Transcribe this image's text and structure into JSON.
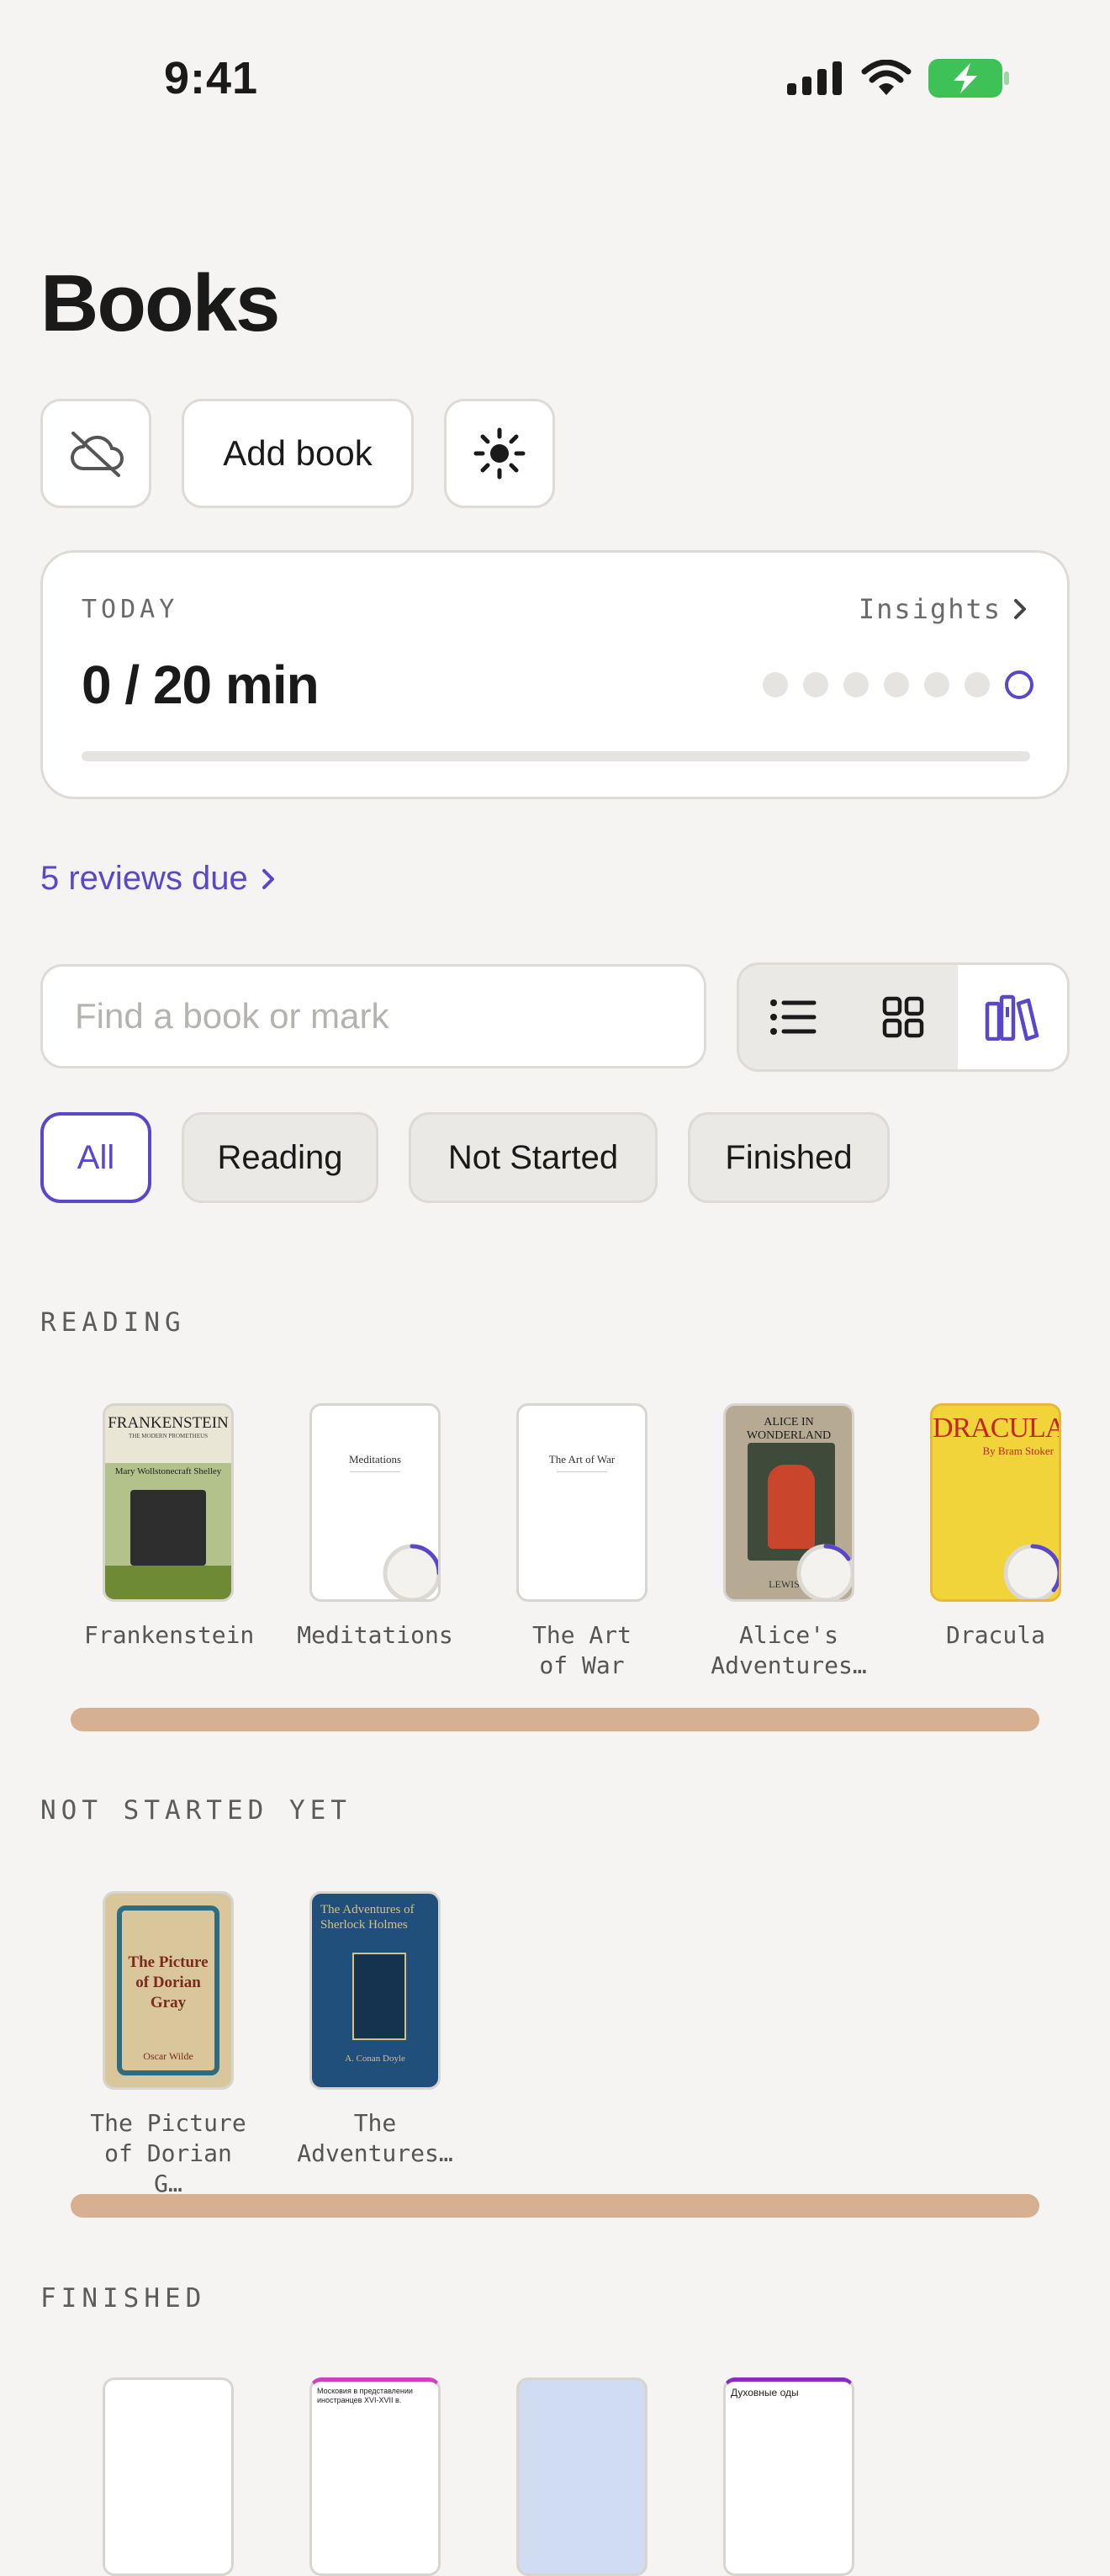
{
  "status_bar": {
    "time": "9:41"
  },
  "header": {
    "title": "Books",
    "add_book_label": "Add book"
  },
  "today": {
    "label": "TODAY",
    "insights_label": "Insights",
    "value": "0 / 20 min",
    "progress_fraction": 0,
    "week_dots": 7
  },
  "reviews_link": "5 reviews due",
  "search": {
    "placeholder": "Find a book or mark"
  },
  "view_modes": [
    "list",
    "grid",
    "shelf"
  ],
  "active_view": "shelf",
  "filters": [
    "All",
    "Reading",
    "Not Started",
    "Finished"
  ],
  "active_filter": "All",
  "sections": {
    "reading": {
      "label": "READING",
      "books": [
        {
          "title_lines": [
            "Frankenstein"
          ],
          "progress": 0,
          "cover": "frankenstein"
        },
        {
          "title_lines": [
            "Meditations"
          ],
          "progress": 0.3,
          "cover": "meditations"
        },
        {
          "title_lines": [
            "The Art",
            "of War"
          ],
          "progress": 0,
          "cover": "art-of-war"
        },
        {
          "title_lines": [
            "Alice's",
            "Adventures…"
          ],
          "progress": 0.2,
          "cover": "alice"
        },
        {
          "title_lines": [
            "Dracula"
          ],
          "progress": 0.4,
          "cover": "dracula"
        }
      ]
    },
    "not_started": {
      "label": "NOT STARTED YET",
      "books": [
        {
          "title_lines": [
            "The Picture",
            "of Dorian G…"
          ],
          "cover": "dorian"
        },
        {
          "title_lines": [
            "The",
            "Adventures…"
          ],
          "cover": "holmes"
        }
      ]
    },
    "finished": {
      "label": "FINISHED"
    }
  },
  "cover_text": {
    "frankenstein": {
      "t1": "FRANKENSTEIN",
      "t2": "THE MODERN PROMETHEUS",
      "t3": "Mary Wollstonecraft Shelley"
    },
    "meditations": {
      "t1": "Meditations"
    },
    "art_of_war": {
      "t1": "The Art of War"
    },
    "alice": {
      "t1": "ALICE IN WONDERLAND",
      "t2": "LEWIS C"
    },
    "dracula": {
      "t1": "DRACULA",
      "t2": "By Bram Stoker"
    },
    "dorian": {
      "t1": "The Picture of Dorian Gray",
      "t2": "Oscar Wilde"
    },
    "holmes": {
      "t1": "The Adventures of Sherlock Holmes",
      "t2": "A. Conan Doyle"
    },
    "finished_2": {
      "t1": "Московия в представлении иностранцев XVI-XVII в."
    },
    "finished_4": {
      "t1": "Духовные оды"
    }
  },
  "colors": {
    "accent": "#5a47c9",
    "shelf": "#d6b091",
    "background": "#f5f4f2"
  }
}
